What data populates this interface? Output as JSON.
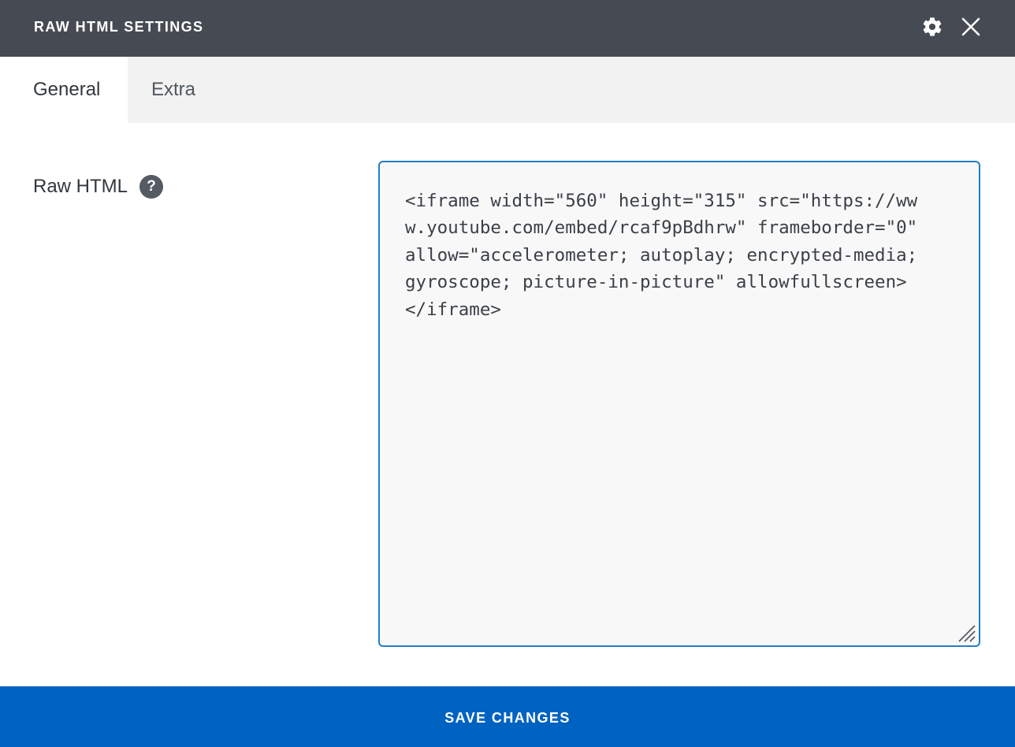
{
  "header": {
    "title": "RAW HTML SETTINGS",
    "icons": [
      "gear-icon",
      "close-icon"
    ]
  },
  "tabs": [
    {
      "label": "General",
      "active": true
    },
    {
      "label": "Extra",
      "active": false
    }
  ],
  "field": {
    "label": "Raw HTML",
    "help_glyph": "?",
    "value": "<iframe width=\"560\" height=\"315\" src=\"https://ww\nw.youtube.com/embed/rcaf9pBdhrw\" frameborder=\"0\"\nallow=\"accelerometer; autoplay; encrypted-media;\ngyroscope; picture-in-picture\" allowfullscreen>\n</iframe>"
  },
  "footer": {
    "save_label": "SAVE CHANGES"
  },
  "colors": {
    "header_bg": "#464b53",
    "tabbar_bg": "#f1f2f1",
    "accent_border": "#1f7fc7",
    "save_bg": "#0063c1"
  }
}
